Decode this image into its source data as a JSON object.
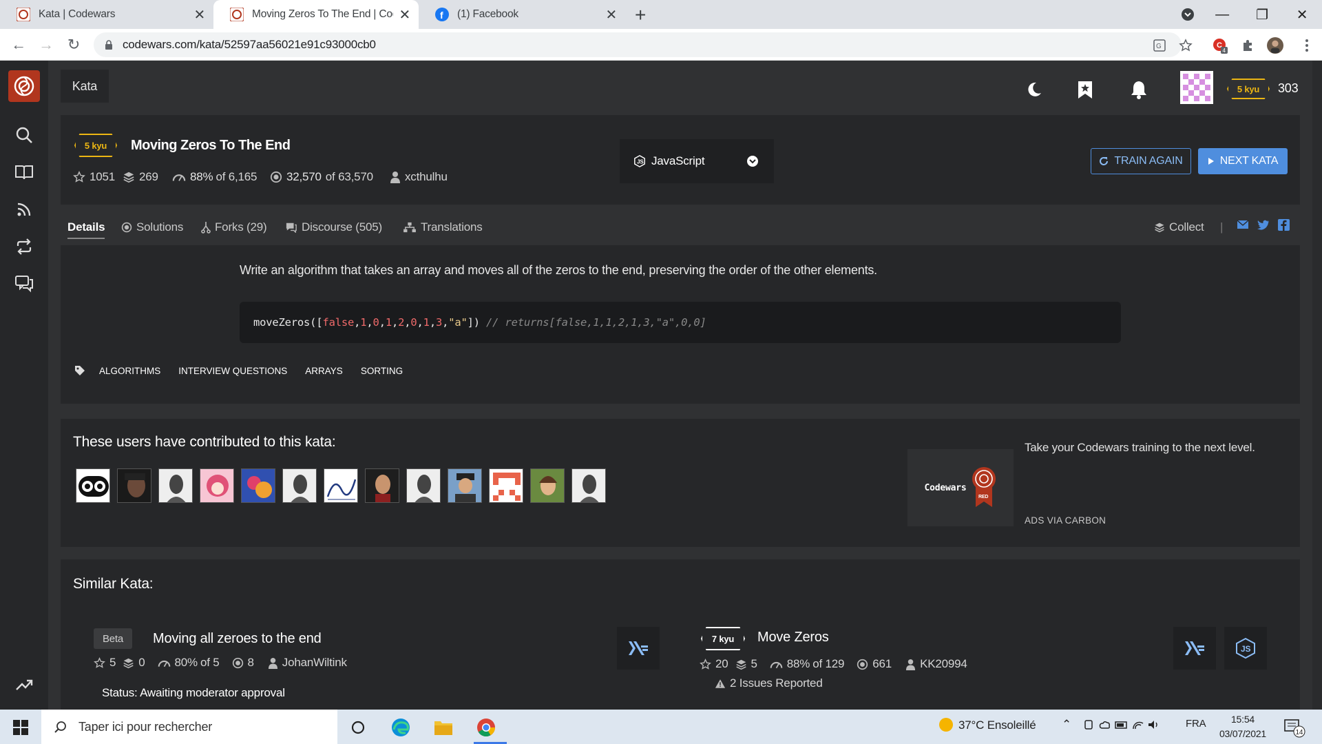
{
  "browser": {
    "tabs": [
      {
        "title": "Kata | Codewars",
        "icon": "codewars-favicon",
        "active": false
      },
      {
        "title": "Moving Zeros To The End | Codewars",
        "icon": "codewars-favicon",
        "active": true
      },
      {
        "title": "(1) Facebook",
        "icon": "facebook-favicon",
        "active": false
      }
    ],
    "url": "codewars.com/kata/52597aa56021e91c93000cb0",
    "extension_badge": "4"
  },
  "header": {
    "kata_tab": "Kata",
    "rank": "5 kyu",
    "honor": "303"
  },
  "kata": {
    "rank": "5 kyu",
    "title": "Moving Zeros To The End",
    "stars": "1051",
    "collections": "269",
    "satisfaction": "88%",
    "satisfaction_of": "of 6,165",
    "completed": "32,570",
    "completed_of": "of 63,570",
    "author": "xcthulhu",
    "language": "JavaScript",
    "train_again": "TRAIN AGAIN",
    "next_kata": "NEXT KATA"
  },
  "subnav": {
    "details": "Details",
    "solutions": "Solutions",
    "forks": "Forks (29)",
    "discourse": "Discourse (505)",
    "translations": "Translations",
    "collect": "Collect",
    "separator": "|"
  },
  "description": {
    "text": "Write an algorithm that takes an array and moves all of the zeros to the end, preserving the order of the other elements.",
    "code": {
      "fn": "moveZeros([",
      "args": [
        {
          "t": "false",
          "c": "red"
        },
        {
          "t": ",",
          "c": "plain"
        },
        {
          "t": "1",
          "c": "red"
        },
        {
          "t": ",",
          "c": "plain"
        },
        {
          "t": "0",
          "c": "red"
        },
        {
          "t": ",",
          "c": "plain"
        },
        {
          "t": "1",
          "c": "red"
        },
        {
          "t": ",",
          "c": "plain"
        },
        {
          "t": "2",
          "c": "red"
        },
        {
          "t": ",",
          "c": "plain"
        },
        {
          "t": "0",
          "c": "red"
        },
        {
          "t": ",",
          "c": "plain"
        },
        {
          "t": "1",
          "c": "red"
        },
        {
          "t": ",",
          "c": "plain"
        },
        {
          "t": "3",
          "c": "red"
        },
        {
          "t": ",",
          "c": "plain"
        },
        {
          "t": "\"a\"",
          "c": "str"
        }
      ],
      "close": "])",
      "comment": "// returns[false,1,1,2,1,3,\"a\",0,0]"
    },
    "tags": [
      "ALGORITHMS",
      "INTERVIEW QUESTIONS",
      "ARRAYS",
      "SORTING"
    ]
  },
  "contributors": {
    "title": "These users have contributed to this kata:",
    "count": 13
  },
  "ad": {
    "text": "Take your Codewars training to the next level.",
    "brand": "Codewars",
    "ribbon": "RED",
    "via": "ADS VIA CARBON"
  },
  "similar": {
    "title": "Similar Kata:",
    "items": [
      {
        "badge": "Beta",
        "name": "Moving all zeroes to the end",
        "stars": "5",
        "collections": "0",
        "satisfaction": "80%",
        "satisfaction_of": "of 5",
        "completed": "8",
        "author": "JohanWiltink",
        "status": "Status:  Awaiting moderator approval"
      },
      {
        "badge": "7 kyu",
        "name": "Move Zeros",
        "stars": "20",
        "collections": "5",
        "satisfaction": "88%",
        "satisfaction_of": "of 129",
        "completed": "661",
        "author": "KK20994",
        "issues": "2 Issues Reported"
      }
    ]
  },
  "taskbar": {
    "search_placeholder": "Taper ici pour rechercher",
    "weather": "37°C  Ensoleillé",
    "lang": "FRA",
    "time": "15:54",
    "date": "03/07/2021",
    "notif_count": "14"
  },
  "colors": {
    "accent": "#4f8ede",
    "rank_yellow": "#ecb613",
    "brand_red": "#b1361e",
    "background": "#303133",
    "panel": "#262729"
  }
}
